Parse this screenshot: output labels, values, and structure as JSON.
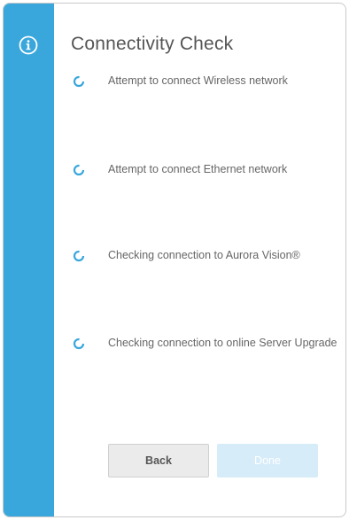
{
  "dialog": {
    "title": "Connectivity Check"
  },
  "sidebar": {
    "icon": "info-icon",
    "color": "#3aa7dc"
  },
  "checks": [
    {
      "label": "Attempt to connect Wireless network",
      "status_icon": "spinner-icon"
    },
    {
      "label": "Attempt to connect Ethernet network",
      "status_icon": "spinner-icon"
    },
    {
      "label": "Checking connection to Aurora Vision®",
      "status_icon": "spinner-icon"
    },
    {
      "label": "Checking connection to online Server Upgrade",
      "status_icon": "spinner-icon"
    }
  ],
  "buttons": {
    "back_label": "Back",
    "done_label": "Done"
  }
}
